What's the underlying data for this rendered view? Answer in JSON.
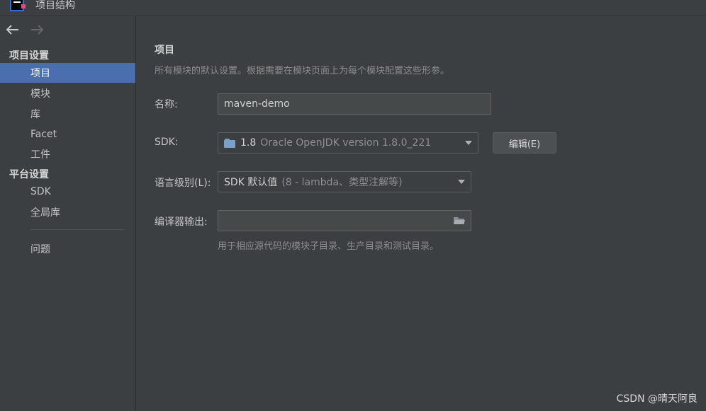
{
  "window": {
    "title": "项目结构",
    "icon": "intellij-app-icon"
  },
  "toolbar": {
    "back_icon": "arrow-left-icon",
    "forward_icon": "arrow-right-icon"
  },
  "sidebar": {
    "project_settings_title": "项目设置",
    "platform_settings_title": "平台设置",
    "project_items": [
      {
        "label": "项目",
        "selected": true
      },
      {
        "label": "模块",
        "selected": false
      },
      {
        "label": "库",
        "selected": false
      },
      {
        "label": "Facet",
        "selected": false
      },
      {
        "label": "工件",
        "selected": false
      }
    ],
    "platform_items": [
      {
        "label": "SDK"
      },
      {
        "label": "全局库"
      }
    ],
    "problems_label": "问题"
  },
  "main": {
    "title": "项目",
    "description": "所有模块的默认设置。根据需要在模块页面上为每个模块配置这些形参。",
    "name_label": "名称:",
    "name_value": "maven-demo",
    "sdk_label": "SDK:",
    "sdk_version": "1.8",
    "sdk_detail": "Oracle OpenJDK version 1.8.0_221",
    "sdk_icon": "sdk-folder-icon",
    "edit_button": "编辑(E)",
    "language_level_label": "语言级别(L):",
    "language_level_value": "SDK 默认值",
    "language_level_detail": "(8 - lambda、类型注解等)",
    "output_label": "编译器输出:",
    "output_value": "",
    "output_browse_icon": "folder-open-icon",
    "output_hint": "用于相应源代码的模块子目录、生产目录和测试目录。"
  },
  "watermark": "CSDN @晴天阿良",
  "colors": {
    "background": "#3c3f41",
    "selection": "#4b6eaf",
    "text": "#c5c5c5"
  }
}
